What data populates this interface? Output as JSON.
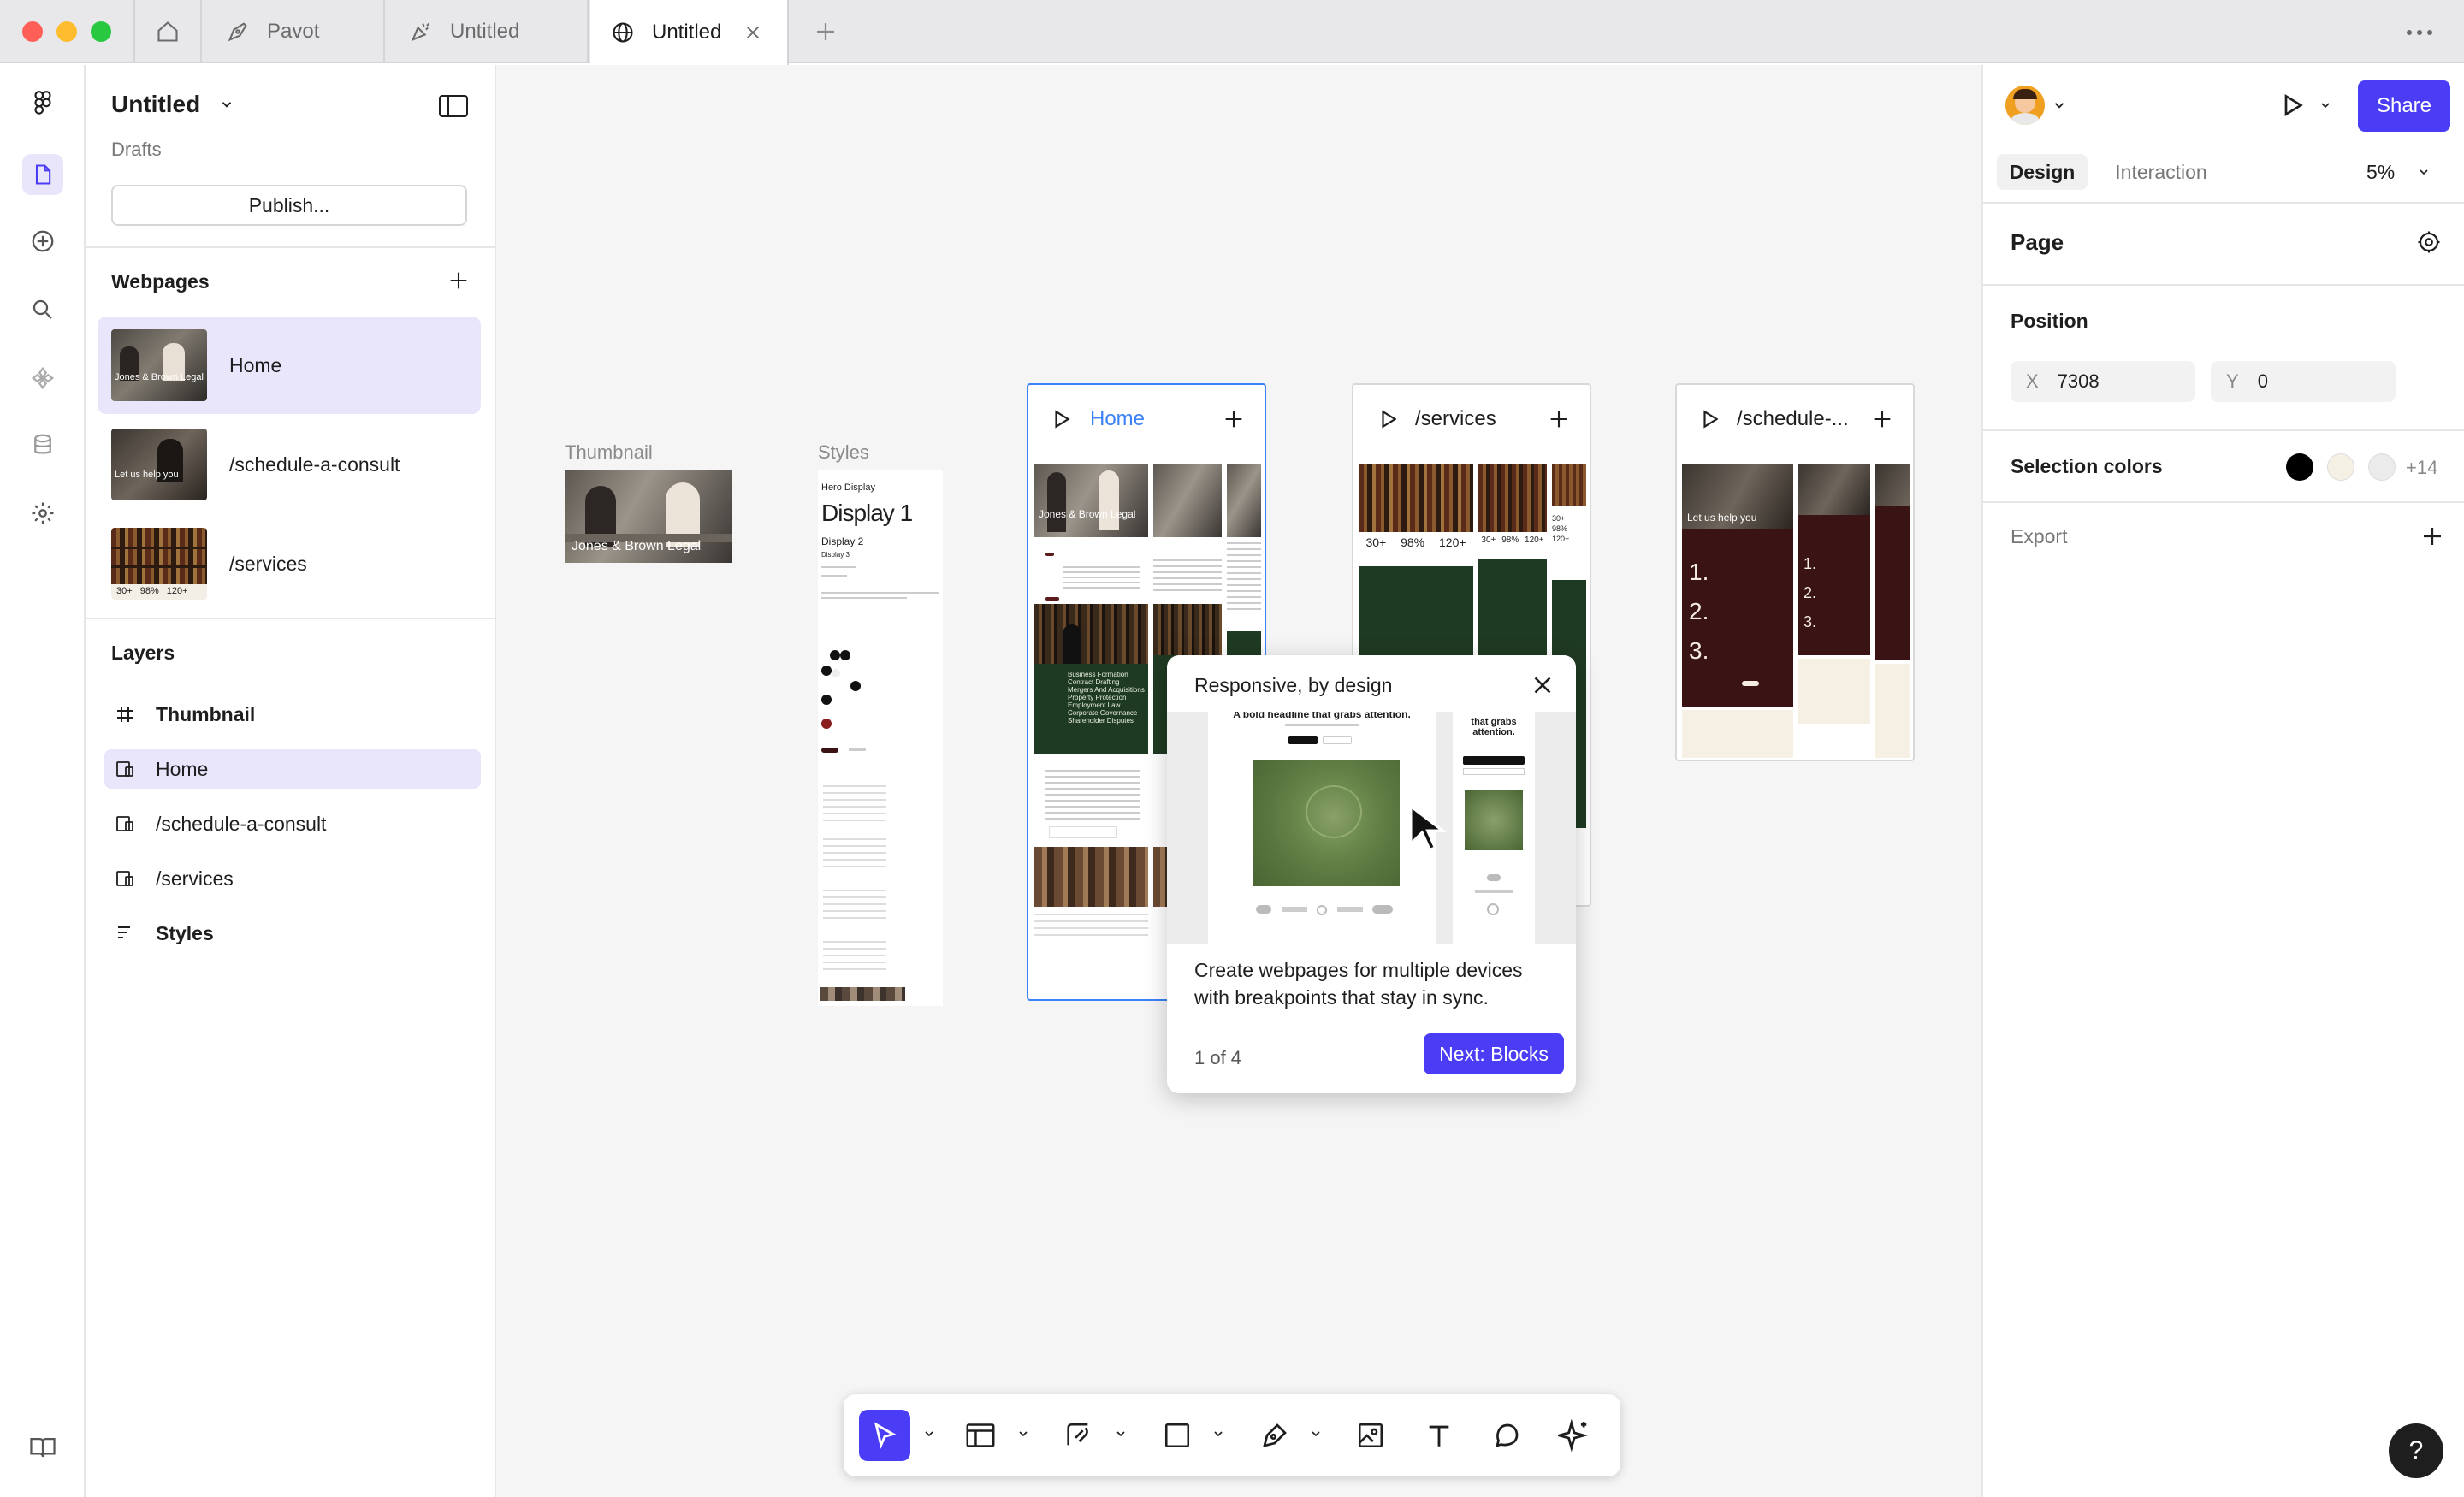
{
  "tabs": [
    {
      "label": "Pavot",
      "icon": "pen-nib-icon"
    },
    {
      "label": "Untitled",
      "icon": "party-icon"
    },
    {
      "label": "Untitled",
      "icon": "globe-icon",
      "active": true
    }
  ],
  "file": {
    "title": "Untitled",
    "location": "Drafts",
    "publish_label": "Publish..."
  },
  "webpages": {
    "title": "Webpages",
    "items": [
      {
        "label": "Home",
        "thumb_text": "Jones & Brown Legal"
      },
      {
        "label": "/schedule-a-consult",
        "thumb_text": "Let us help you"
      },
      {
        "label": "/services",
        "thumb_text": "30+ 98% 120+"
      }
    ]
  },
  "layers": {
    "title": "Layers",
    "items": [
      {
        "label": "Thumbnail",
        "icon": "frame-hash-icon"
      },
      {
        "label": "Home",
        "icon": "breakpoint-icon"
      },
      {
        "label": "/schedule-a-consult",
        "icon": "breakpoint-icon"
      },
      {
        "label": "/services",
        "icon": "breakpoint-icon"
      },
      {
        "label": "Styles",
        "icon": "styles-icon"
      }
    ]
  },
  "canvas": {
    "thumbnail_label": "Thumbnail",
    "thumbnail_text": "Jones & Brown Legal",
    "styles_label": "Styles",
    "styles": {
      "hero": "Hero Display",
      "d1": "Display 1",
      "d2": "Display 2",
      "d3": "Display 3"
    },
    "home": {
      "label": "Home",
      "hero": "Jones & Brown Legal",
      "services_list": "Business Formation Contract Drafting Mergers And Acquisitions Property Protection Employment Law Corporate Governance Shareholder Disputes"
    },
    "services": {
      "label": "/services",
      "stats": [
        "30+",
        "98%",
        "120+"
      ]
    },
    "schedule": {
      "label": "/schedule-...",
      "hero": "Let us help you",
      "steps": [
        "1.",
        "2.",
        "3."
      ]
    }
  },
  "popover": {
    "title": "Responsive, by design",
    "preview_headline": "A bold headline that grabs attention.",
    "preview_side": "that grabs attention.",
    "body": "Create webpages for multiple devices with breakpoints that stay in sync.",
    "step": "1 of 4",
    "next_label": "Next: Blocks"
  },
  "right": {
    "share_label": "Share",
    "tabs": [
      "Design",
      "Interaction"
    ],
    "zoom": "5%",
    "page_title": "Page",
    "position_title": "Position",
    "x_label": "X",
    "x_value": "7308",
    "y_label": "Y",
    "y_value": "0",
    "selection_colors_title": "Selection colors",
    "selection_colors": [
      "#000000",
      "#f5f0e4",
      "#ebebeb"
    ],
    "more_colors": "+14",
    "export_title": "Export"
  },
  "help_label": "?",
  "colors": {
    "accent": "#4b3df5",
    "selected_bg": "#e9e6fb",
    "legal_green": "#1f3a22",
    "legal_maroon": "#3a1414"
  }
}
